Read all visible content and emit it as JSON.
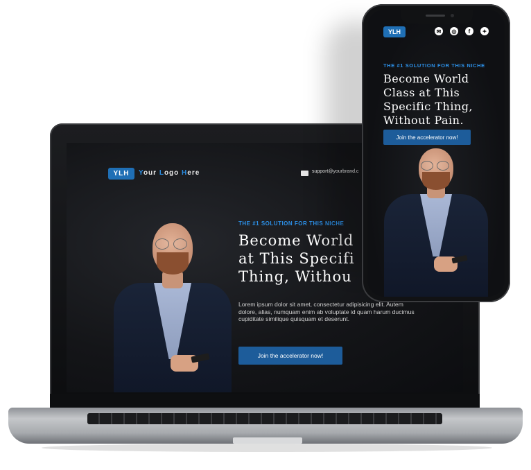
{
  "brand": {
    "logo_mark": "YLH",
    "logo_text_parts": [
      "Y",
      "our ",
      "L",
      "ogo ",
      "H",
      "ere"
    ],
    "accent_color": "#1f6fb5"
  },
  "laptop": {
    "email": "support@yourbrand.c",
    "eyebrow": "THE #1 SOLUTION FOR THIS NICHE",
    "headline_lines": [
      "Become World",
      "at This Specifi",
      "Thing, Withou"
    ],
    "body": "Lorem ipsum dolor sit amet, consectetur adipisicing elit. Autem dolore, alias, numquam enim ab voluptate id quam harum ducimus cupiditate similique quisquam et deserunt.",
    "cta": "Join the accelerator now!"
  },
  "phone": {
    "social_icons": [
      "mail-icon",
      "instagram-icon",
      "facebook-icon",
      "twitter-icon"
    ],
    "eyebrow": "THE #1 SOLUTION FOR THIS NICHE",
    "headline_lines": [
      "Become World",
      "Class at This",
      "Specific Thing,",
      "Without Pain."
    ],
    "cta": "Join the accelerator now!"
  }
}
